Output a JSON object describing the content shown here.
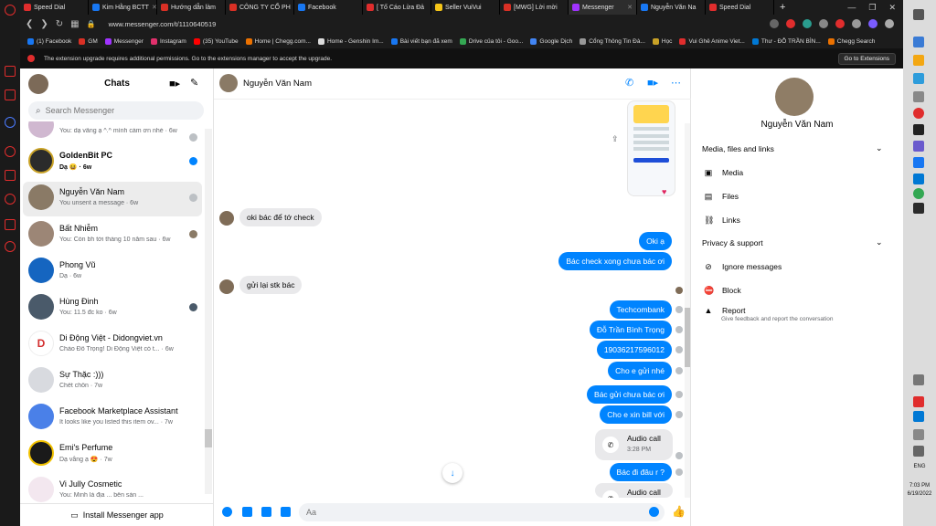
{
  "browser": {
    "tabs": [
      {
        "label": "Speed Dial",
        "color": "#e02d2d"
      },
      {
        "label": "Kim Hằng BCTT",
        "color": "#1877f2"
      },
      {
        "label": "Hướng dẫn làm",
        "color": "#d93025"
      },
      {
        "label": "CÔNG TY CỔ PH",
        "color": "#d93025"
      },
      {
        "label": "Facebook",
        "color": "#1877f2"
      },
      {
        "label": "[ Tố Cáo Lừa Đả",
        "color": "#e02d2d"
      },
      {
        "label": "Seller VuiVui",
        "color": "#f5c518"
      },
      {
        "label": "[MWG] Lời mời",
        "color": "#d93025"
      },
      {
        "label": "Messenger",
        "color": "#a033ff"
      },
      {
        "label": "Nguyễn Văn Na",
        "color": "#1877f2"
      },
      {
        "label": "Speed Dial",
        "color": "#e02d2d"
      }
    ],
    "url": "www.messenger.com/t/1110640519",
    "bookmarks": [
      "(1) Facebook",
      "GM",
      "Messenger",
      "Instagram",
      "(35) YouTube",
      "Home | Chegg.com...",
      "Home - Genshin Im...",
      "Bài viết bạn đã xem",
      "Drive của tôi - Goo...",
      "Google Dịch",
      "Cổng Thông Tin Đà...",
      "Học",
      "Vui Ghê Anime Viet...",
      "Thư - ĐỖ TRẦN BÌN...",
      "Chegg Search"
    ],
    "notice": "The extension upgrade requires additional permissions. Go to the extensions manager to accept the upgrade.",
    "notice_button": "Go to Extensions"
  },
  "chatlist": {
    "title": "Chats",
    "search_placeholder": "Search Messenger",
    "install": "Install Messenger app",
    "conversations": [
      {
        "name": "",
        "preview": "You: dạ vâng ạ ^.^ mình cảm ơn nhé · 6w",
        "color": "#d0b8d0"
      },
      {
        "name": "GoldenBit PC",
        "preview": "Dạ 😆 · 6w",
        "color": "#2b2b2b",
        "unread": true
      },
      {
        "name": "Nguyễn Văn Nam",
        "preview": "You unsent a message · 6w",
        "color": "#8a7a66",
        "selected": true
      },
      {
        "name": "Bất Nhiễm",
        "preview": "You: Còn bh tới tháng 10 năm sau · 6w",
        "color": "#9c8676"
      },
      {
        "name": "Phong Vũ",
        "preview": "Dạ · 6w",
        "color": "#1565c0"
      },
      {
        "name": "Hùng Đinh",
        "preview": "You: 11.5 đc ko · 6w",
        "color": "#4a5a6a"
      },
      {
        "name": "Di Động Việt - Didongviet.vn",
        "preview": "Chào Đỗ Trọng! Di Động Việt có t... · 6w",
        "color": "#ffffff"
      },
      {
        "name": "Sự Thặc :)))",
        "preview": "Chết chôn · 7w",
        "color": "#d8dadf"
      },
      {
        "name": "Facebook Marketplace Assistant",
        "preview": "It looks like you listed this item ov... · 7w",
        "color": "#4a80e8"
      },
      {
        "name": "Emi's Perfume",
        "preview": "Dạ vâng ạ 😍 · 7w",
        "color": "#1a1a1a"
      },
      {
        "name": "Vi Jully Cosmetic",
        "preview": "You: Minh là địa ...  bên sàn ...",
        "color": "#f3e7ef"
      }
    ]
  },
  "conversation": {
    "name": "Nguyễn Văn Nam",
    "messages": [
      {
        "text": "oki bác để tớ check",
        "dir": "in"
      },
      {
        "text": "Oki ạ",
        "dir": "out"
      },
      {
        "text": "Bác check xong chưa bác ơi",
        "dir": "out"
      },
      {
        "text": "gửi lại stk bác",
        "dir": "in"
      },
      {
        "text": "Techcombank",
        "dir": "out"
      },
      {
        "text": "Đỗ Trần Bình Trọng",
        "dir": "out"
      },
      {
        "text": "19036217596012",
        "dir": "out"
      },
      {
        "text": "Cho e gửi nhé",
        "dir": "out"
      },
      {
        "text": "Bác gửi chưa bác ơi",
        "dir": "out"
      },
      {
        "text": "Cho e xin bill với",
        "dir": "out"
      },
      {
        "text": "Bác đi đâu r ?",
        "dir": "out"
      }
    ],
    "calls": [
      {
        "title": "Audio call",
        "time": "3:28 PM"
      },
      {
        "title": "Audio call",
        "time": ""
      }
    ],
    "input_placeholder": "Aa"
  },
  "info": {
    "name": "Nguyễn Văn Nam",
    "sec1": "Media, files and links",
    "media": "Media",
    "files": "Files",
    "links": "Links",
    "sec2": "Privacy & support",
    "ignore": "Ignore messages",
    "block": "Block",
    "report": "Report",
    "report_sub": "Give feedback and report the conversation"
  },
  "taskbar": {
    "lang": "ENG",
    "time": "7:03 PM",
    "date": "6/19/2022"
  }
}
